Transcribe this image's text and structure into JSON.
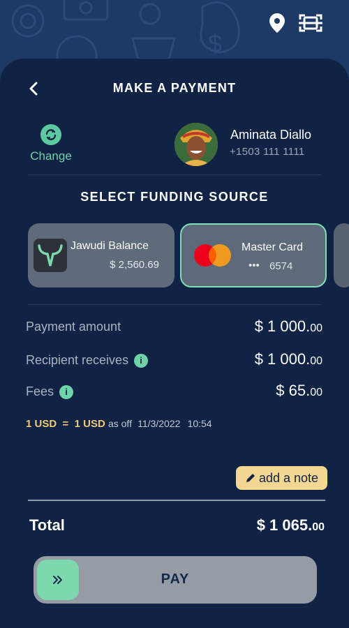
{
  "header": {
    "title": "MAKE A PAYMENT"
  },
  "recipient": {
    "change_label": "Change",
    "name": "Aminata Diallo",
    "phone": "+1503 111 1111"
  },
  "funding": {
    "title": "SELECT FUNDING SOURCE",
    "cards": [
      {
        "name": "Jawudi Balance",
        "amount": "$ 2,560.69",
        "selected": false
      },
      {
        "name": "Master Card",
        "masked": "•••",
        "last4": "6574",
        "selected": true
      }
    ]
  },
  "summary": {
    "payment_amount": {
      "label": "Payment amount",
      "value": "$ 1 000.",
      "cents": "00"
    },
    "recipient_receives": {
      "label": "Recipient receives",
      "value": "$ 1 000.",
      "cents": "00"
    },
    "fees": {
      "label": "Fees",
      "value": "$ 65.",
      "cents": "00"
    },
    "rate": {
      "rate_text": "1 USD  =  1 USD",
      "as_of": "as off",
      "date": "11/3/2022",
      "time": "10:54"
    }
  },
  "note_button": {
    "label": "add a note"
  },
  "total": {
    "label": "Total",
    "value": "$ 1 065.",
    "cents": "00"
  },
  "pay_button": {
    "label": "PAY"
  },
  "colors": {
    "accent": "#6ed3a8",
    "background": "#0f2244",
    "gold": "#f1c876",
    "note_bg": "#f4d792"
  },
  "icons": [
    "location-pin-icon",
    "scan-icon",
    "back-arrow-icon",
    "refresh-icon",
    "info-icon",
    "pencil-icon",
    "double-chevron-right-icon",
    "mastercard-logo",
    "jawudi-logo"
  ]
}
